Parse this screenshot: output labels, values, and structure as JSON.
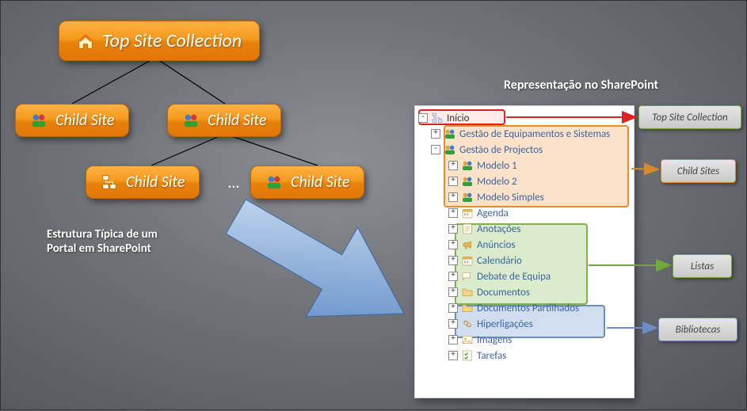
{
  "hierarchy": {
    "top": "Top Site Collection",
    "child": "Child Site"
  },
  "captions": {
    "left": "Estrutura Típica de um\nPortal em SharePoint",
    "header": "Representação no SharePoint"
  },
  "tree": {
    "root": "Início",
    "items": [
      {
        "label": "Gestão de Equipamentos e Sistemas",
        "indent": 1,
        "exp": "+",
        "icon": "people"
      },
      {
        "label": "Gestão de Projectos",
        "indent": 1,
        "exp": "-",
        "icon": "people"
      },
      {
        "label": "Modelo 1",
        "indent": 2,
        "exp": "+",
        "icon": "people"
      },
      {
        "label": "Modelo 2",
        "indent": 2,
        "exp": "+",
        "icon": "people"
      },
      {
        "label": "Modelo Simples",
        "indent": 2,
        "exp": "+",
        "icon": "people"
      },
      {
        "label": "Agenda",
        "indent": 2,
        "exp": "+",
        "icon": "cal"
      },
      {
        "label": "Anotações",
        "indent": 2,
        "exp": "+",
        "icon": "note"
      },
      {
        "label": "Anúncios",
        "indent": 2,
        "exp": "+",
        "icon": "announce"
      },
      {
        "label": "Calendário",
        "indent": 2,
        "exp": "+",
        "icon": "cal"
      },
      {
        "label": "Debate de Equipa",
        "indent": 2,
        "exp": "+",
        "icon": "discuss"
      },
      {
        "label": "Documentos",
        "indent": 2,
        "exp": "+",
        "icon": "folder"
      },
      {
        "label": "Documentos Partilhados",
        "indent": 2,
        "exp": "+",
        "icon": "folder"
      },
      {
        "label": "Hiperligações",
        "indent": 2,
        "exp": "+",
        "icon": "link"
      },
      {
        "label": "Imagens",
        "indent": 2,
        "exp": "+",
        "icon": "image"
      },
      {
        "label": "Tarefas",
        "indent": 2,
        "exp": "+",
        "icon": "task"
      }
    ]
  },
  "callouts": {
    "top": "Top Site Collection",
    "child": "Child Sites",
    "lists": "Listas",
    "libs": "Bibliotecas"
  }
}
